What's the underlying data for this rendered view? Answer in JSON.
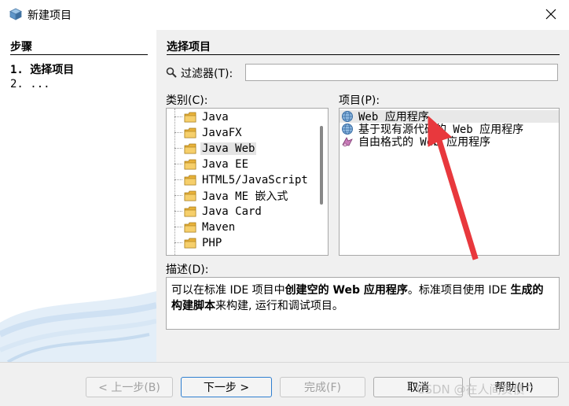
{
  "window": {
    "title": "新建项目",
    "icon": "netbeans-cube-icon"
  },
  "steps": {
    "title": "步骤",
    "items": [
      "1. 选择项目",
      "2. ..."
    ]
  },
  "main": {
    "title": "选择项目",
    "filter": {
      "label": "过滤器(T):",
      "value": ""
    },
    "categories": {
      "label": "类别(C):",
      "items": [
        "Java",
        "JavaFX",
        "Java Web",
        "Java EE",
        "HTML5/JavaScript",
        "Java ME 嵌入式",
        "Java Card",
        "Maven",
        "PHP"
      ],
      "selected": "Java Web"
    },
    "projects": {
      "label": "项目(P):",
      "items": [
        {
          "text": "Web 应用程序",
          "icon": "globe-icon"
        },
        {
          "text": "基于现有源代码的 Web 应用程序",
          "icon": "globe-icon"
        },
        {
          "text": "自由格式的 Web 应用程序",
          "icon": "freeform-icon"
        }
      ],
      "selected": "Web 应用程序"
    },
    "description": {
      "label": "描述(D):",
      "p1": "可以在标准 IDE 项目中",
      "b1": "创建空的 Web 应用程序",
      "p2": "。标准项目使用 IDE ",
      "b2": "生成的构建脚本",
      "p3": "来构建, 运行和调试项目。"
    }
  },
  "buttons": {
    "back": "< 上一步(B)",
    "next": "下一步 >",
    "finish": "完成(F)",
    "cancel": "取消",
    "help": "帮助(H)"
  },
  "watermark": "CSDN @在人间负债^",
  "colors": {
    "arrow": "#e8383d",
    "button_border": "#2f7fd0",
    "folder": "#e8b23a"
  }
}
